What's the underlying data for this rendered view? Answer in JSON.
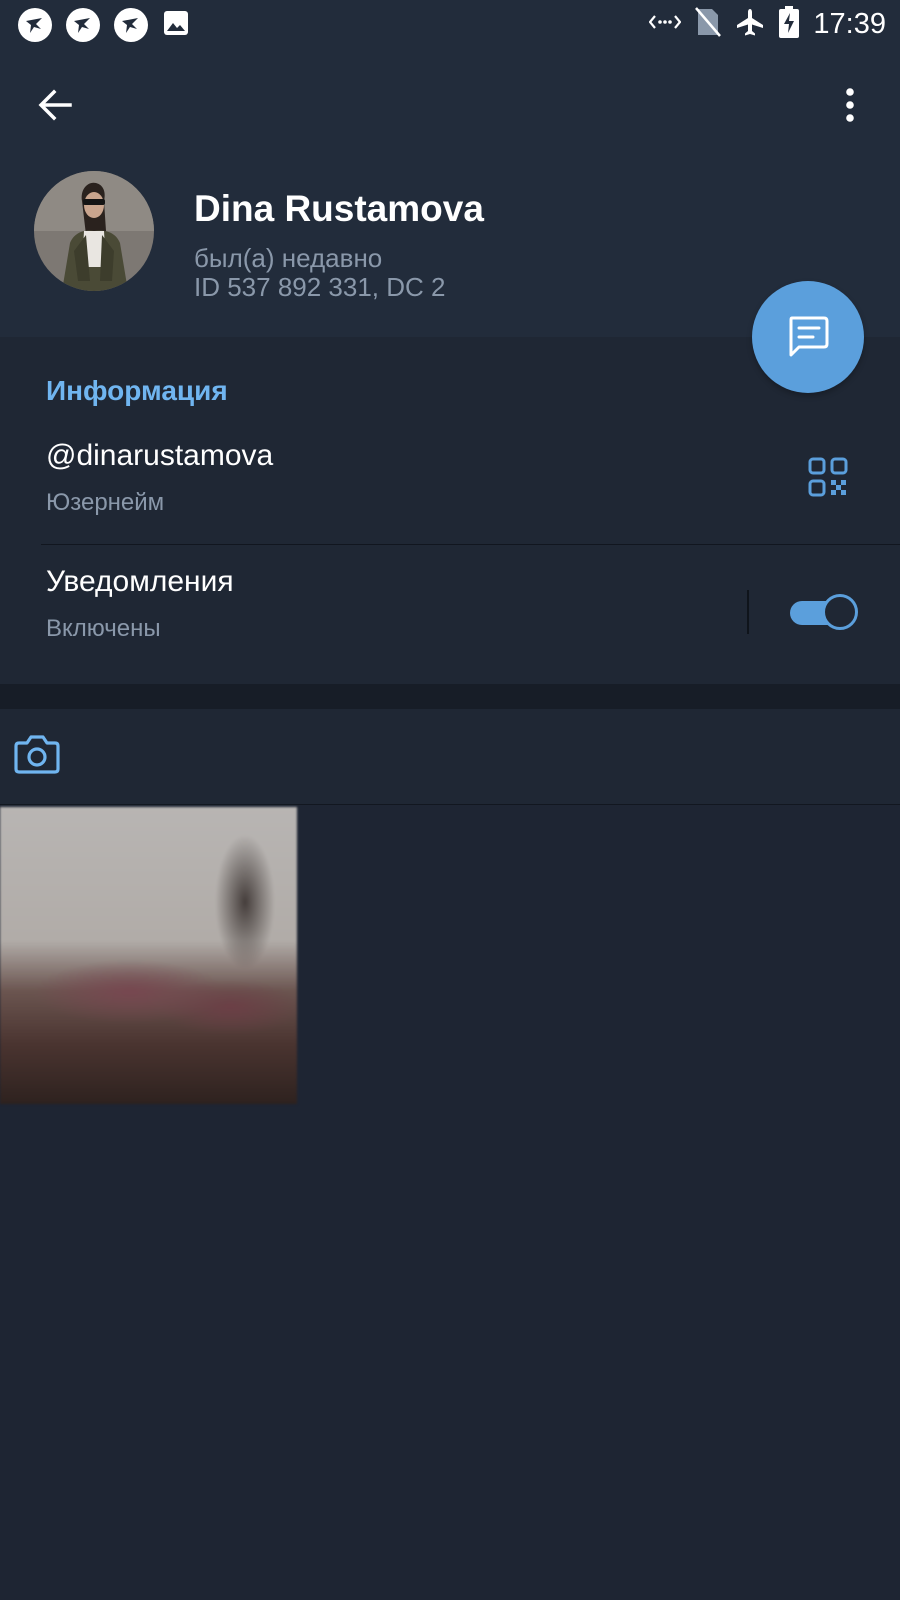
{
  "status_bar": {
    "time": "17:39",
    "left_icons": [
      "app-notification-icon",
      "app-notification-icon",
      "app-notification-icon",
      "image-icon"
    ],
    "right_icons": [
      "data-arrows-icon",
      "no-sim-icon",
      "airplane-icon",
      "battery-charging-icon"
    ]
  },
  "header": {
    "back_icon": "arrow-left-icon",
    "menu_icon": "more-vertical-icon",
    "name": "Dina Rustamova",
    "status": "был(а) недавно",
    "user_id": "ID 537 892 331, DC 2",
    "message_button_icon": "chat-icon"
  },
  "info": {
    "section_title": "Информация",
    "username": {
      "value": "@dinarustamova",
      "label": "Юзернейм",
      "action_icon": "qr-code-icon"
    },
    "notifications": {
      "value": "Уведомления",
      "label": "Включены",
      "enabled": true
    }
  },
  "media_tabs": {
    "tabs": [
      {
        "icon": "camera-icon",
        "selected": true
      }
    ]
  },
  "colors": {
    "accent": "#5b9fdc",
    "section_title": "#70b5f0",
    "background": "#1e2533",
    "header_background": "#222c3b",
    "secondary_text": "#8a98aa"
  }
}
